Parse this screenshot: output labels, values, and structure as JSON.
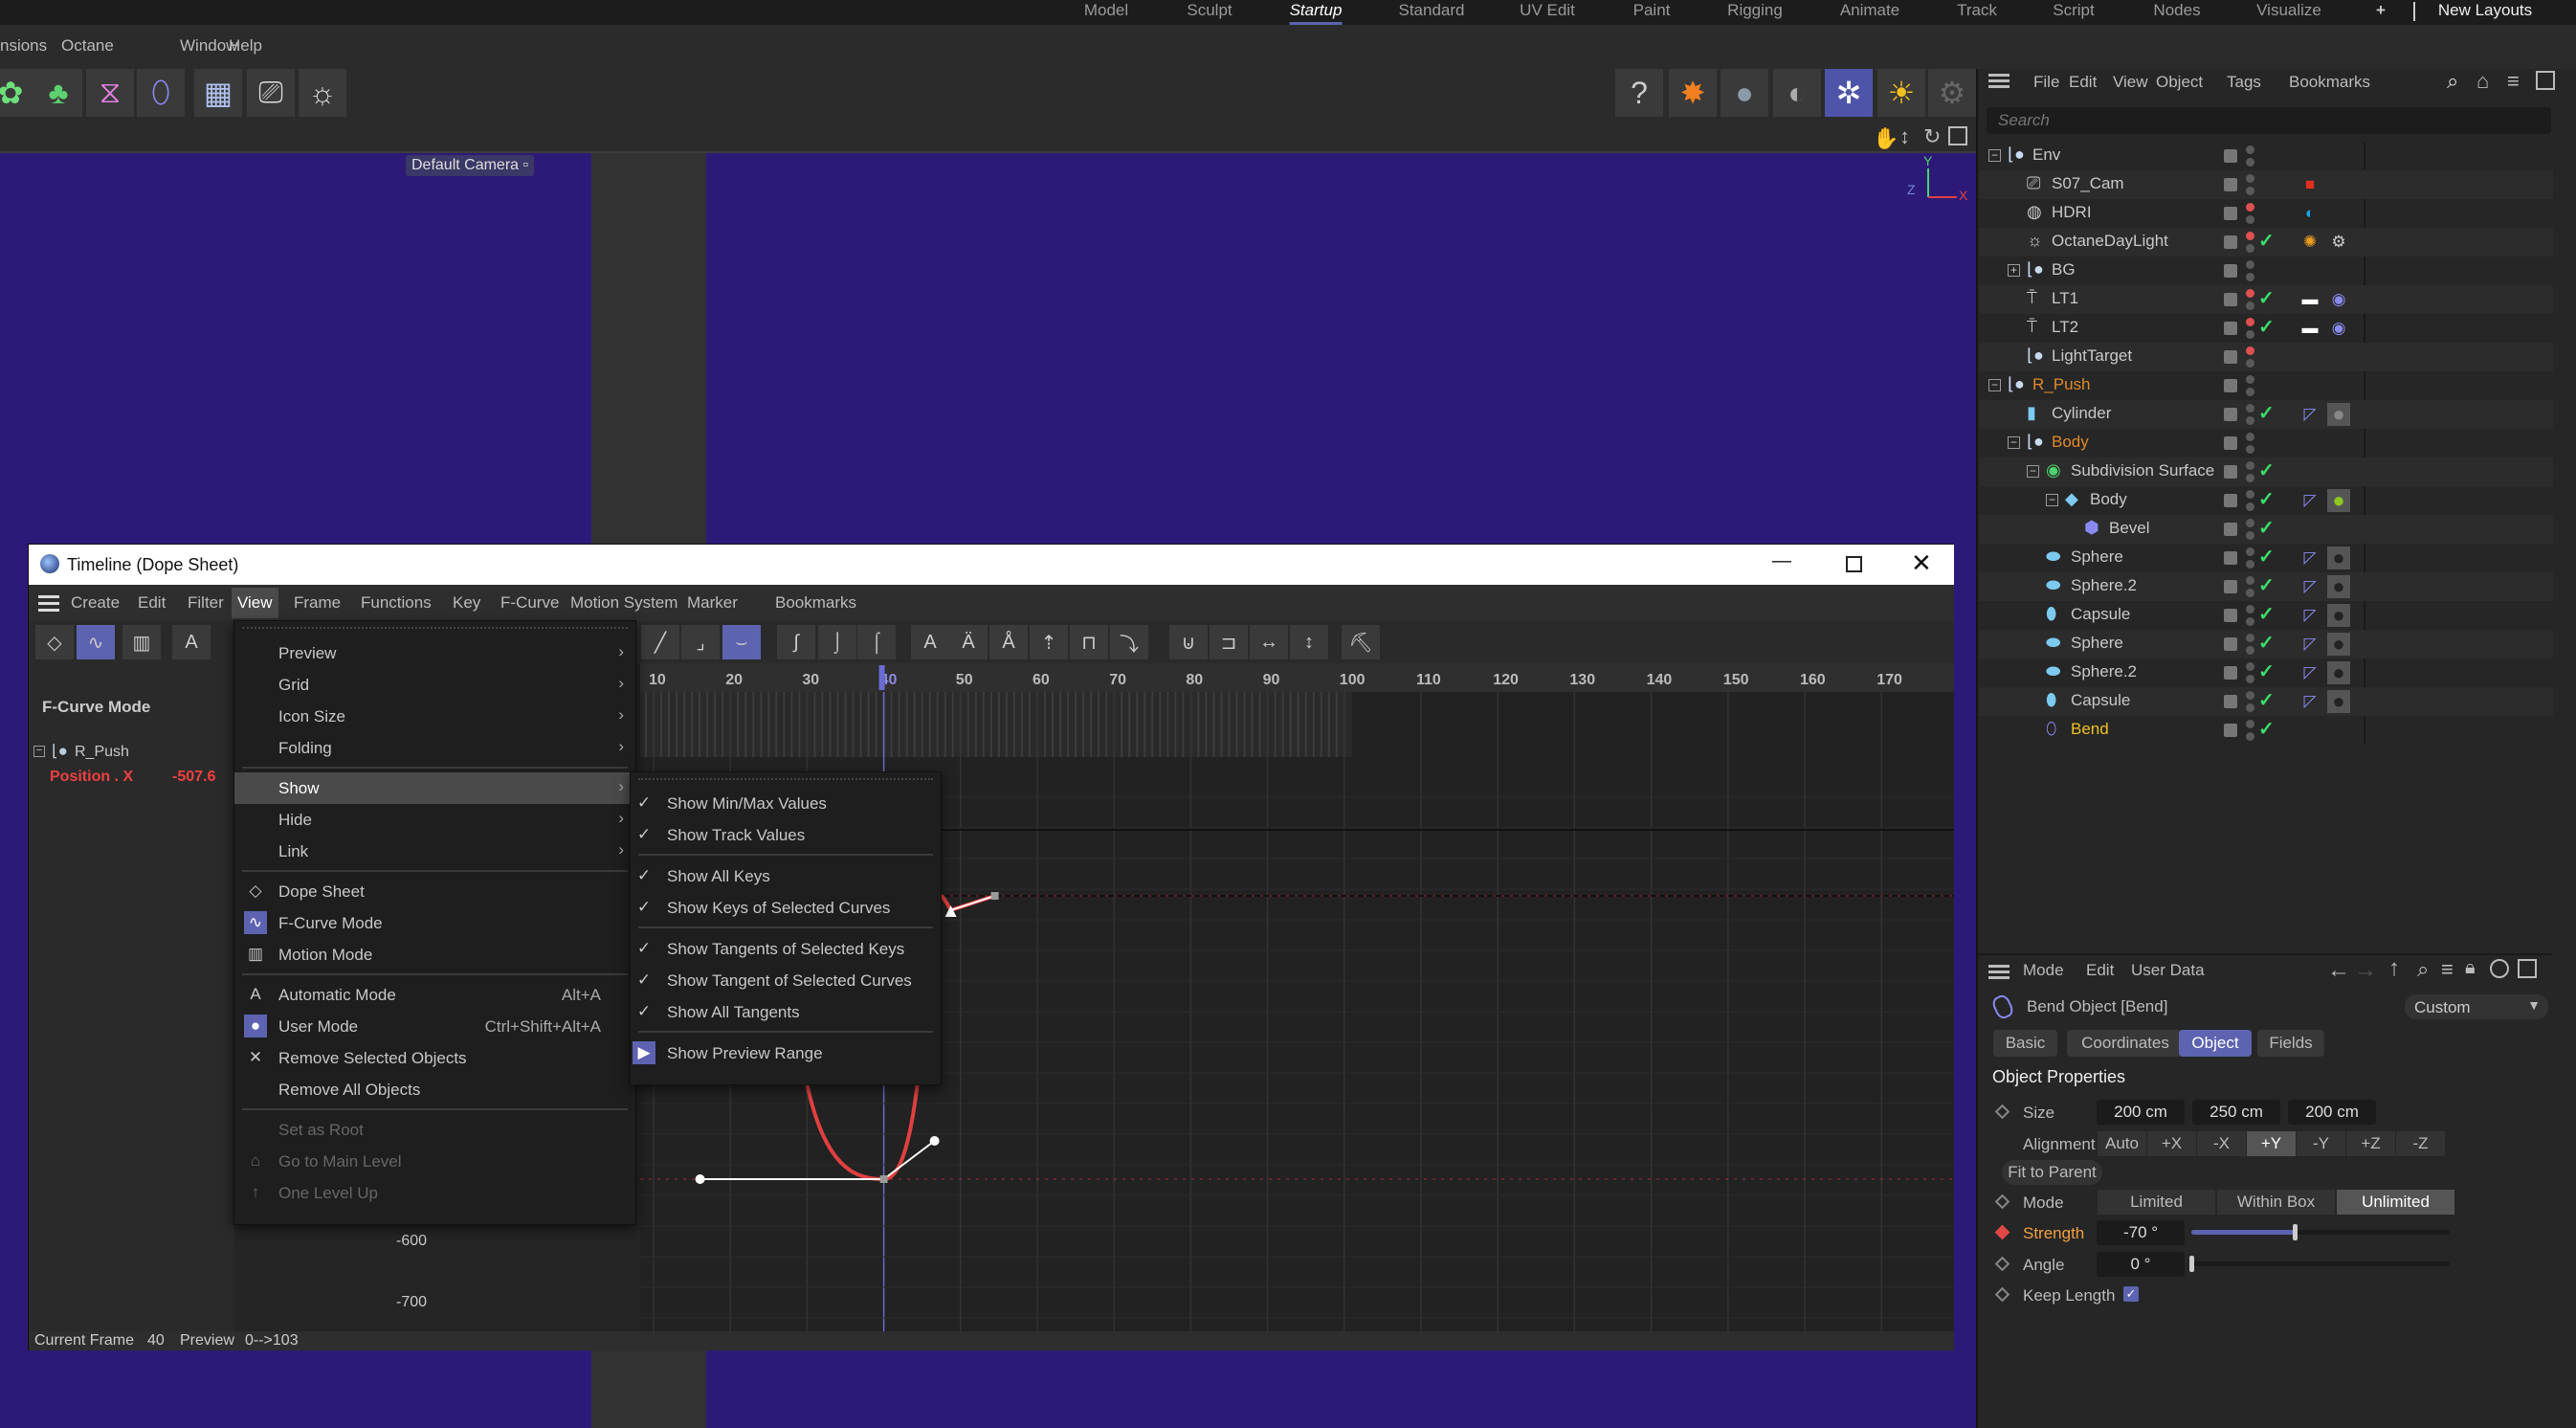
{
  "layouts": {
    "tabs": [
      "Model",
      "Sculpt",
      "Startup",
      "Standard",
      "UV Edit",
      "Paint",
      "Rigging",
      "Animate",
      "Track",
      "Script",
      "Nodes",
      "Visualize"
    ],
    "active": "Startup",
    "add": "+",
    "new_layouts": "New Layouts"
  },
  "main_menu": [
    "nsions",
    "Octane",
    "Window",
    "Help"
  ],
  "toolbar_left": [
    "gear-cloner-icon",
    "mograph-cluster-icon",
    "symmetry-icon",
    "bend-deformer-icon",
    "grid-icon",
    "octane-camera-icon",
    "octane-light-icon"
  ],
  "toolbar_right": [
    "octane-help-icon",
    "octane-render-icon",
    "octane-material-icon",
    "octane-mix-material-icon",
    "octane-live-viewer-icon",
    "octane-daylight-icon",
    "octane-settings-icon"
  ],
  "viewport": {
    "camera_label": "Default Camera",
    "axis": {
      "y": "Y",
      "z": "Z",
      "x": "X"
    }
  },
  "object_manager": {
    "menu": [
      "File",
      "Edit",
      "View",
      "Object",
      "Tags",
      "Bookmarks"
    ],
    "search_placeholder": "Search",
    "objects": [
      {
        "name": "Env",
        "depth": 0,
        "exp": "-",
        "icon": "null",
        "color": "#c8c8c8",
        "dots": [
          "#5a5a5a",
          "#5a5a5a"
        ],
        "check": false,
        "tags": []
      },
      {
        "name": "S07_Cam",
        "depth": 1,
        "exp": "",
        "icon": "camera",
        "color": "#c8c8c8",
        "dots": [
          "#5a5a5a",
          "#5a5a5a"
        ],
        "check": false,
        "tags": [
          "camera-tag"
        ]
      },
      {
        "name": "HDRI",
        "depth": 1,
        "exp": "",
        "icon": "sky",
        "color": "#c8c8c8",
        "dots": [
          "#e05050",
          "#5a5a5a"
        ],
        "check": false,
        "tags": [
          "environment-tag"
        ]
      },
      {
        "name": "OctaneDayLight",
        "depth": 1,
        "exp": "",
        "icon": "daylight",
        "color": "#c8c8c8",
        "dots": [
          "#e05050",
          "#5a5a5a"
        ],
        "check": true,
        "tags": [
          "sun-tag",
          "settings-tag"
        ]
      },
      {
        "name": "BG",
        "depth": 1,
        "exp": "+",
        "icon": "null",
        "color": "#c8c8c8",
        "dots": [
          "#5a5a5a",
          "#5a5a5a"
        ],
        "check": false,
        "tags": []
      },
      {
        "name": "LT1",
        "depth": 1,
        "exp": "",
        "icon": "arealight",
        "color": "#c8c8c8",
        "dots": [
          "#e05050",
          "#5a5a5a"
        ],
        "check": true,
        "tags": [
          "light-tag",
          "target-tag"
        ]
      },
      {
        "name": "LT2",
        "depth": 1,
        "exp": "",
        "icon": "arealight",
        "color": "#c8c8c8",
        "dots": [
          "#e05050",
          "#5a5a5a"
        ],
        "check": true,
        "tags": [
          "light-tag",
          "target-tag"
        ]
      },
      {
        "name": "LightTarget",
        "depth": 1,
        "exp": "",
        "icon": "null",
        "color": "#c8c8c8",
        "dots": [
          "#e05050",
          "#5a5a5a"
        ],
        "check": false,
        "tags": []
      },
      {
        "name": "R_Push",
        "depth": 0,
        "exp": "-",
        "icon": "null",
        "color": "#e0892a",
        "dots": [
          "#5a5a5a",
          "#5a5a5a"
        ],
        "check": false,
        "tags": []
      },
      {
        "name": "Cylinder",
        "depth": 1,
        "exp": "",
        "icon": "cylinder",
        "color": "#c8c8c8",
        "dots": [
          "#5a5a5a",
          "#5a5a5a"
        ],
        "check": true,
        "tags": [
          "phong-tag",
          "material-grey"
        ]
      },
      {
        "name": "Body",
        "depth": 1,
        "exp": "-",
        "icon": "null",
        "color": "#e0892a",
        "dots": [
          "#5a5a5a",
          "#5a5a5a"
        ],
        "check": false,
        "tags": []
      },
      {
        "name": "Subdivision Surface",
        "depth": 2,
        "exp": "-",
        "icon": "subdiv",
        "color": "#c8c8c8",
        "dots": [
          "#5a5a5a",
          "#5a5a5a"
        ],
        "check": true,
        "tags": []
      },
      {
        "name": "Body",
        "depth": 3,
        "exp": "-",
        "icon": "cube",
        "color": "#c8c8c8",
        "dots": [
          "#5a5a5a",
          "#5a5a5a"
        ],
        "check": true,
        "tags": [
          "phong-tag",
          "material-green"
        ]
      },
      {
        "name": "Bevel",
        "depth": 4,
        "exp": "",
        "icon": "bevel",
        "color": "#c8c8c8",
        "dots": [
          "#5a5a5a",
          "#5a5a5a"
        ],
        "check": true,
        "tags": []
      },
      {
        "name": "Sphere",
        "depth": 2,
        "exp": "",
        "icon": "sphere",
        "color": "#c8c8c8",
        "dots": [
          "#5a5a5a",
          "#5a5a5a"
        ],
        "check": true,
        "tags": [
          "phong-tag",
          "material-black"
        ]
      },
      {
        "name": "Sphere.2",
        "depth": 2,
        "exp": "",
        "icon": "sphere",
        "color": "#c8c8c8",
        "dots": [
          "#5a5a5a",
          "#5a5a5a"
        ],
        "check": true,
        "tags": [
          "phong-tag",
          "material-black"
        ]
      },
      {
        "name": "Capsule",
        "depth": 2,
        "exp": "",
        "icon": "capsule",
        "color": "#c8c8c8",
        "dots": [
          "#5a5a5a",
          "#5a5a5a"
        ],
        "check": true,
        "tags": [
          "phong-tag",
          "material-black"
        ]
      },
      {
        "name": "Sphere",
        "depth": 2,
        "exp": "",
        "icon": "sphere",
        "color": "#c8c8c8",
        "dots": [
          "#5a5a5a",
          "#5a5a5a"
        ],
        "check": true,
        "tags": [
          "phong-tag",
          "material-black"
        ]
      },
      {
        "name": "Sphere.2",
        "depth": 2,
        "exp": "",
        "icon": "sphere",
        "color": "#c8c8c8",
        "dots": [
          "#5a5a5a",
          "#5a5a5a"
        ],
        "check": true,
        "tags": [
          "phong-tag",
          "material-black"
        ]
      },
      {
        "name": "Capsule",
        "depth": 2,
        "exp": "",
        "icon": "capsule",
        "color": "#c8c8c8",
        "dots": [
          "#5a5a5a",
          "#5a5a5a"
        ],
        "check": true,
        "tags": [
          "phong-tag",
          "material-black"
        ]
      },
      {
        "name": "Bend",
        "depth": 2,
        "exp": "",
        "icon": "bend",
        "color": "#f0c020",
        "dots": [
          "#5a5a5a",
          "#5a5a5a"
        ],
        "check": true,
        "tags": []
      }
    ]
  },
  "attributes": {
    "menu": [
      "Mode",
      "Edit",
      "User Data"
    ],
    "object_title": "Bend Object [Bend]",
    "preset": "Custom",
    "tabs": [
      "Basic",
      "Coordinates",
      "Object",
      "Fields"
    ],
    "active_tab": "Object",
    "section": "Object Properties",
    "size_label": "Size",
    "size": [
      "200 cm",
      "250 cm",
      "200 cm"
    ],
    "alignment_label": "Alignment",
    "alignment": [
      "Auto",
      "+X",
      "-X",
      "+Y",
      "-Y",
      "+Z",
      "-Z"
    ],
    "alignment_selected": "+Y",
    "fit_to_parent": "Fit to Parent",
    "mode_label": "Mode",
    "modes": [
      "Limited",
      "Within Box",
      "Unlimited"
    ],
    "mode_selected": "Unlimited",
    "strength_label": "Strength",
    "strength": "-70 °",
    "strength_slider": 0.4,
    "angle_label": "Angle",
    "angle": "0 °",
    "angle_slider": 0,
    "keep_length_label": "Keep Length",
    "keep_length": true,
    "accent": "#5d63b0",
    "keyed_color": "#f0a040"
  },
  "timeline": {
    "title": "Timeline (Dope Sheet)",
    "menu": [
      "Create",
      "Edit",
      "Filter",
      "View",
      "Frame",
      "Functions",
      "Key",
      "F-Curve",
      "Motion System",
      "Marker",
      "Bookmarks"
    ],
    "active_menu": "View",
    "mode_label": "F-Curve Mode",
    "object": "R_Push",
    "track": "Position . X",
    "track_value": "-507.6",
    "ruler": [
      10,
      20,
      30,
      40,
      50,
      60,
      70,
      80,
      90,
      100,
      110,
      120,
      130,
      140,
      150,
      160,
      170
    ],
    "current_frame": 40,
    "y_labels": [
      "-600",
      "-700"
    ],
    "status": {
      "current_frame_label": "Current Frame",
      "current_frame": "40",
      "preview_label": "Preview",
      "preview": "0-->103"
    },
    "curve_color": "#e04040"
  },
  "view_menu": {
    "items": [
      {
        "label": "Preview",
        "arrow": true
      },
      {
        "label": "Grid",
        "arrow": true
      },
      {
        "label": "Icon Size",
        "arrow": true
      },
      {
        "label": "Folding",
        "arrow": true
      },
      {
        "label": "Show",
        "arrow": true,
        "highlight": true
      },
      {
        "label": "Hide",
        "arrow": true
      },
      {
        "label": "Link",
        "arrow": true
      },
      {
        "label": "Dope Sheet",
        "icon": "dope-sheet"
      },
      {
        "label": "F-Curve Mode",
        "icon": "f-curve"
      },
      {
        "label": "Motion Mode",
        "icon": "motion"
      },
      {
        "label": "Automatic Mode",
        "icon": "A",
        "shortcut": "Alt+A"
      },
      {
        "label": "User Mode",
        "icon": "user",
        "shortcut": "Ctrl+Shift+Alt+A"
      },
      {
        "label": "Remove Selected Objects",
        "icon": "x"
      },
      {
        "label": "Remove All Objects"
      },
      {
        "label": "Set as Root",
        "disabled": true
      },
      {
        "label": "Go to Main Level",
        "icon": "home",
        "disabled": true
      },
      {
        "label": "One Level Up",
        "icon": "up",
        "disabled": true
      }
    ]
  },
  "show_submenu": {
    "items": [
      {
        "label": "Show Min/Max Values",
        "checked": true
      },
      {
        "label": "Show Track Values",
        "checked": true
      },
      {
        "label": "Show All Keys",
        "checked": true
      },
      {
        "label": "Show Keys of Selected Curves",
        "checked": true
      },
      {
        "label": "Show Tangents of Selected Keys",
        "checked": true
      },
      {
        "label": "Show Tangent of Selected Curves",
        "checked": true
      },
      {
        "label": "Show All Tangents",
        "checked": true
      },
      {
        "label": "Show Preview Range",
        "icon": "preview-range"
      }
    ]
  }
}
